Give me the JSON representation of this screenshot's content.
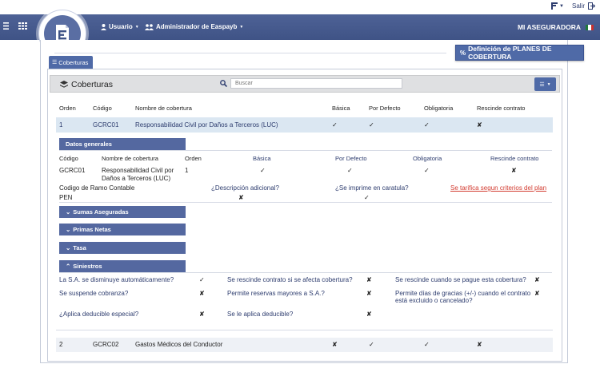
{
  "topbar": {
    "salir_label": "Salir"
  },
  "navbar": {
    "usuario": "Usuario",
    "admin": "Administrador de Easpayb",
    "company": "MI ASEGURADORA"
  },
  "def_button": "Definición de PLANES DE COBERTURA",
  "tab_coberturas": "Coberturas",
  "panel": {
    "title": "Coberturas",
    "search_placeholder": "Buscar"
  },
  "table": {
    "headers": {
      "orden": "Orden",
      "codigo": "Código",
      "nombre": "Nombre de cobertura",
      "basica": "Básica",
      "defecto": "Por Defecto",
      "obligatoria": "Obligatoria",
      "rescinde": "Rescinde contrato"
    },
    "rows": [
      {
        "orden": "1",
        "codigo": "GCRC01",
        "nombre": "Responsabilidad Civil por Daños a Terceros (LUC)",
        "basica": "✓",
        "defecto": "✓",
        "obligatoria": "✓",
        "rescinde": "✘"
      },
      {
        "orden": "2",
        "codigo": "GCRC02",
        "nombre": "Gastos Médicos del Conductor",
        "basica": "✘",
        "defecto": "✓",
        "obligatoria": "✓",
        "rescinde": "✘"
      }
    ]
  },
  "datos_generales": {
    "tab": "Datos generales",
    "headers": {
      "codigo": "Código",
      "nombre": "Nombre de cobertura",
      "orden": "Orden",
      "basica": "Básica",
      "defecto": "Por Defecto",
      "obligatoria": "Obligatoria",
      "rescinde": "Rescinde contrato"
    },
    "values": {
      "codigo": "GCRC01",
      "nombre_l1": "Responsabilidad Civil por",
      "nombre_l2": "Daños a Terceros (LUC)",
      "orden": "1",
      "basica": "✓",
      "defecto": "✓",
      "obligatoria": "✓",
      "rescinde": "✘"
    },
    "ramo_label": "Codigo de Ramo Contable",
    "ramo_value": "PEN",
    "descripcion_label": "¿Descripción adicional?",
    "descripcion_value": "✘",
    "caratula_label": "¿Se imprime en caratula?",
    "caratula_value": "✓",
    "tarifica_link": "Se tarifica segun criterios del plan"
  },
  "sections": {
    "sumas": "Sumas Aseguradas",
    "primas": "Primas Netas",
    "tasa": "Tasa",
    "siniestros": "Siniestros"
  },
  "siniestros": {
    "q1": "La S.A. se disminuye automáticamente?",
    "a1": "✓",
    "q2": "Se rescinde contrato si se afecta cobertura?",
    "a2": "✘",
    "q3": "Se rescinde cuando se pague esta cobertura?",
    "a3": "✘",
    "q4": "Se suspende cobranza?",
    "a4": "✘",
    "q5": "Permite reservas mayores a S.A.?",
    "a5": "✘",
    "q6_l1": "Permite días de gracias (+/-) cuando el contrato",
    "q6_l2": "está excluido o cancelado?",
    "a6": "✘",
    "q7": "¿Aplica deducible especial?",
    "a7": "✘",
    "q8": "Se le aplica deducible?",
    "a8": "✘"
  }
}
